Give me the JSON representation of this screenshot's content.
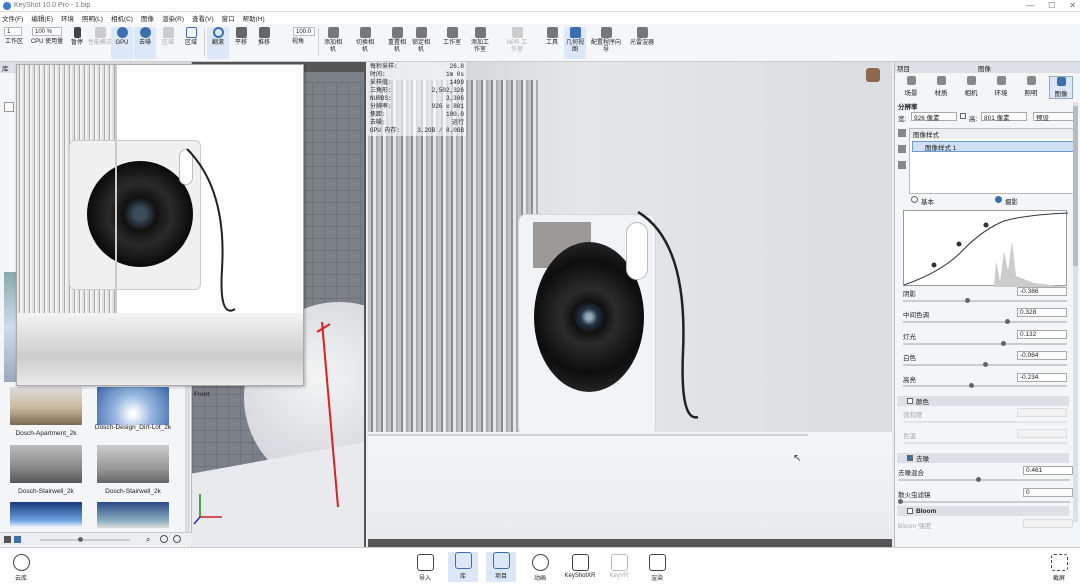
{
  "window": {
    "title": "KeyShot 10.0 Pro - 1.bip"
  },
  "menu": [
    "文件(F)",
    "编辑(E)",
    "环境",
    "照明(L)",
    "相机(C)",
    "图像",
    "渲染(R)",
    "查看(V)",
    "窗口",
    "帮助(H)"
  ],
  "toolbar": {
    "workspace_select": "1",
    "zoom_select": "100 %",
    "fov_value": "100.0",
    "buttons": [
      "工作区",
      "CPU 使用量",
      "暂停",
      "性能模式",
      "GPU",
      "去噪",
      "区域",
      "区域",
      "翻滚",
      "平移",
      "推移",
      "视角",
      "添加相机",
      "切换相机",
      "重置相机",
      "锁定相机",
      "工作室",
      "添加工作室",
      "NPR 工作室",
      "工具",
      "几何视图",
      "配置程序向导",
      "光雷渲器"
    ]
  },
  "library": {
    "header": "库",
    "tab_label": "环境",
    "items": [
      {
        "label": "Dosch-Apartment_2k"
      },
      {
        "label": "Dosch-Design_Dirt-Lot_2k"
      },
      {
        "label": "Dosch-Stairwell_2k"
      },
      {
        "label": "Dosch-Stairwell_2k"
      }
    ]
  },
  "render_stats": [
    {
      "k": "每秒采样:",
      "v": "26.8"
    },
    {
      "k": "时间:",
      "v": "1m 0s"
    },
    {
      "k": "采样值:",
      "v": "1499"
    },
    {
      "k": "三角形:",
      "v": "2,502,326"
    },
    {
      "k": "NURBS:",
      "v": "3,306"
    },
    {
      "k": "分辨率:",
      "v": "926 x 801"
    },
    {
      "k": "焦距:",
      "v": "100.0"
    },
    {
      "k": "去噪:",
      "v": "运行"
    },
    {
      "k": "GPU 内存:",
      "v": "3.2GB / 8.0GB"
    }
  ],
  "viewport": {
    "label_front": "Front"
  },
  "right": {
    "header_left": "项目",
    "header_title": "图像",
    "tabs": [
      "场景",
      "材质",
      "相机",
      "环境",
      "照明",
      "图像"
    ],
    "resolution_label": "分辨率",
    "width_label": "宽:",
    "width_value": "926 像素",
    "height_label": "高:",
    "height_value": "801 像素",
    "preset": "预设",
    "style_list_title": "图像样式",
    "style_item": "图像样式 1",
    "mode_basic": "基本",
    "mode_photo": "摄影",
    "params": [
      {
        "label": "阴影",
        "value": "-0.386",
        "frac": 0.38
      },
      {
        "label": "中间色调",
        "value": "0.328",
        "frac": 0.62
      },
      {
        "label": "灯光",
        "value": "0.132",
        "frac": 0.6
      },
      {
        "label": "白色",
        "value": "-0.064",
        "frac": 0.49
      },
      {
        "label": "高亮",
        "value": "-0.234",
        "frac": 0.4
      }
    ],
    "color_section": "颜色",
    "color_params": [
      "饱和度",
      "色温"
    ],
    "denoise_section": "去噪",
    "denoise_params": [
      {
        "label": "去噪混合",
        "value": "0.461"
      },
      {
        "label": "散火虫滤镜",
        "value": "0"
      }
    ],
    "bloom_section": "Bloom",
    "bloom_params": [
      "Bloom 强度"
    ]
  },
  "bottom": {
    "left_label": "云库",
    "buttons": [
      "导入",
      "库",
      "项目",
      "动画",
      "KeyShotXR",
      "KeyVR",
      "渲染"
    ],
    "right_label": "截屏"
  },
  "colors": {
    "accent": "#3d6fb0",
    "active_tab": "#dce8f8"
  }
}
